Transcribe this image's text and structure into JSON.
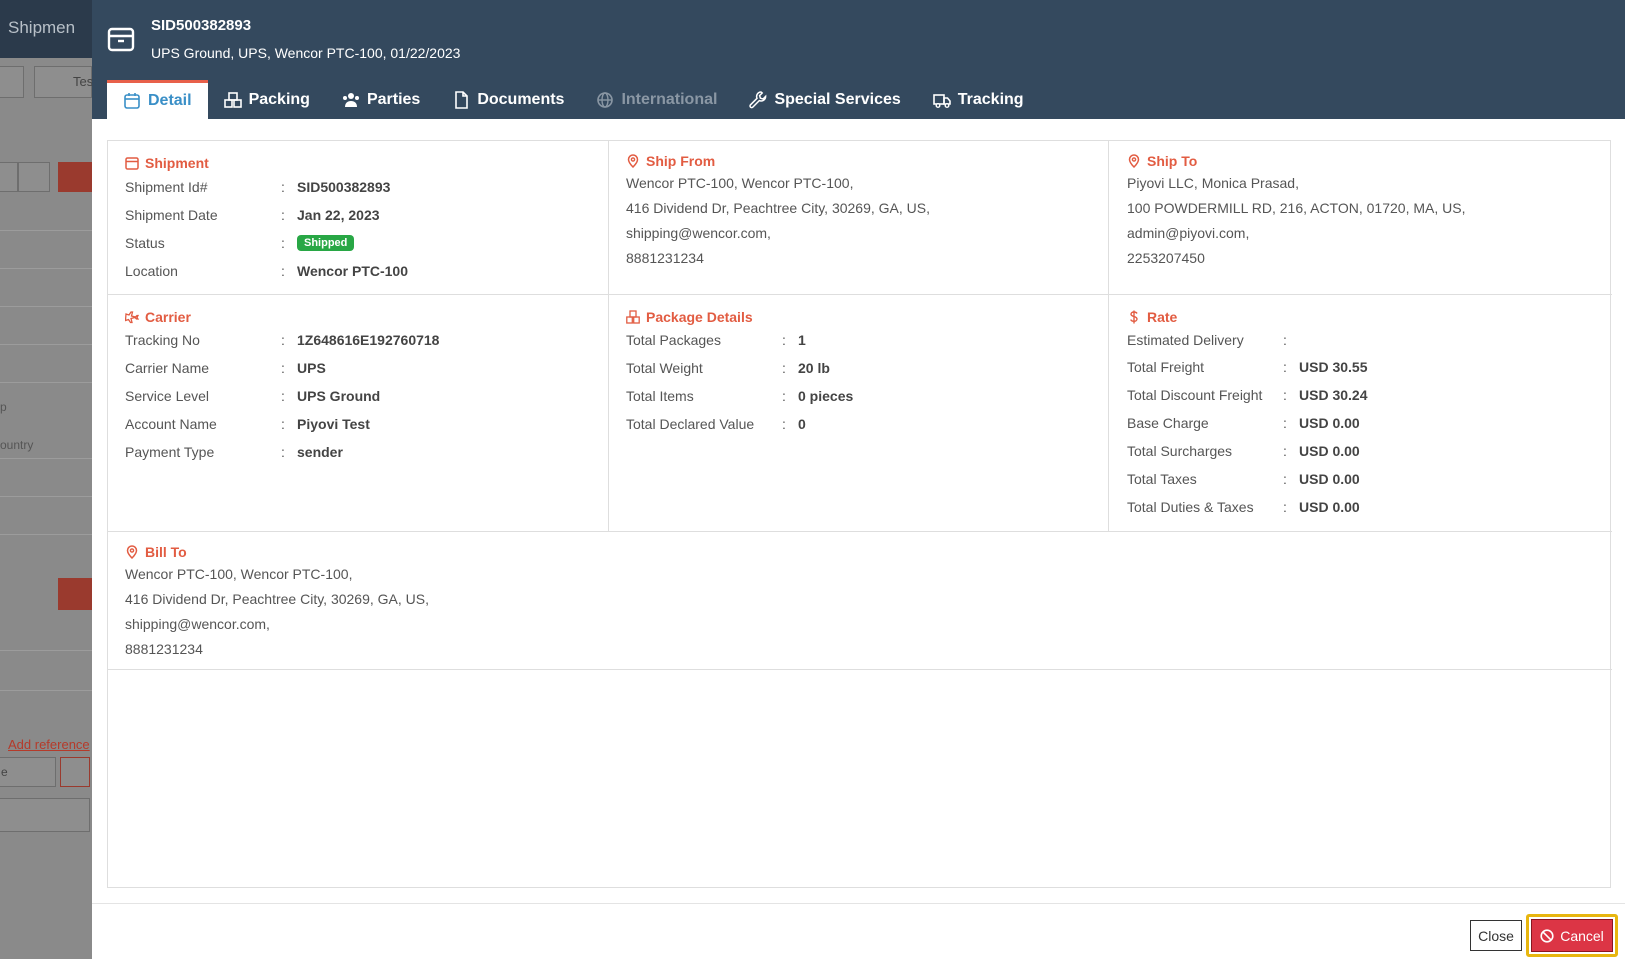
{
  "background": {
    "header_text": "Shipmen",
    "tab_fragment": "Tes",
    "placeholder_zip": "p",
    "placeholder_country": "ountry",
    "add_reference_link": "Add reference",
    "field_fragment": "e"
  },
  "modal": {
    "title": "SID500382893",
    "subtitle": "UPS Ground, UPS, Wencor PTC-100, 01/22/2023",
    "header_icon": "box-icon",
    "tabs": [
      {
        "label": "Detail",
        "icon": "calendar-icon",
        "active": true
      },
      {
        "label": "Packing",
        "icon": "boxes-icon"
      },
      {
        "label": "Parties",
        "icon": "users-icon"
      },
      {
        "label": "Documents",
        "icon": "file-icon"
      },
      {
        "label": "International",
        "icon": "globe-icon",
        "disabled": true
      },
      {
        "label": "Special Services",
        "icon": "wrench-icon"
      },
      {
        "label": "Tracking",
        "icon": "truck-icon"
      }
    ]
  },
  "shipment": {
    "title": "Shipment",
    "rows": [
      {
        "label": "Shipment Id#",
        "value": "SID500382893"
      },
      {
        "label": "Shipment Date",
        "value": "Jan 22, 2023"
      },
      {
        "label": "Status",
        "value": "Shipped"
      },
      {
        "label": "Location",
        "value": "Wencor PTC-100"
      }
    ]
  },
  "ship_from": {
    "title": "Ship From",
    "lines": [
      "Wencor PTC-100, Wencor PTC-100,",
      "416 Dividend Dr, Peachtree City, 30269, GA, US,",
      "shipping@wencor.com,",
      "8881231234"
    ]
  },
  "ship_to": {
    "title": "Ship To",
    "lines": [
      "Piyovi LLC, Monica Prasad,",
      "100 POWDERMILL RD, 216, ACTON, 01720, MA, US,",
      "admin@piyovi.com,",
      "2253207450"
    ]
  },
  "carrier": {
    "title": "Carrier",
    "rows": [
      {
        "label": "Tracking No",
        "value": "1Z648616E192760718"
      },
      {
        "label": "Carrier Name",
        "value": "UPS"
      },
      {
        "label": "Service Level",
        "value": "UPS Ground"
      },
      {
        "label": "Account Name",
        "value": "Piyovi Test"
      },
      {
        "label": "Payment Type",
        "value": "sender"
      }
    ]
  },
  "package": {
    "title": "Package Details",
    "rows": [
      {
        "label": "Total Packages",
        "value": "1"
      },
      {
        "label": "Total Weight",
        "value": "20 lb"
      },
      {
        "label": "Total Items",
        "value": "0 pieces"
      },
      {
        "label": "Total Declared Value",
        "value": "0"
      }
    ]
  },
  "rate": {
    "title": "Rate",
    "rows": [
      {
        "label": "Estimated Delivery",
        "value": ""
      },
      {
        "label": "Total Freight",
        "value": "USD 30.55"
      },
      {
        "label": "Total Discount Freight",
        "value": "USD 30.24"
      },
      {
        "label": "Base Charge",
        "value": "USD 0.00"
      },
      {
        "label": "Total Surcharges",
        "value": "USD 0.00"
      },
      {
        "label": "Total Taxes",
        "value": "USD 0.00"
      },
      {
        "label": "Total Duties & Taxes",
        "value": "USD 0.00"
      }
    ]
  },
  "bill_to": {
    "title": "Bill To",
    "lines": [
      "Wencor PTC-100, Wencor PTC-100,",
      "416 Dividend Dr, Peachtree City, 30269, GA, US,",
      "shipping@wencor.com,",
      "8881231234"
    ]
  },
  "footer": {
    "close_label": "Close",
    "cancel_label": "Cancel"
  },
  "colors": {
    "header_bg": "#34495e",
    "accent_red": "#e25c42",
    "tab_active": "#3a8fc7",
    "status_green": "#28a745",
    "cancel_red": "#dc3545",
    "highlight_yellow": "#e8b60f"
  }
}
